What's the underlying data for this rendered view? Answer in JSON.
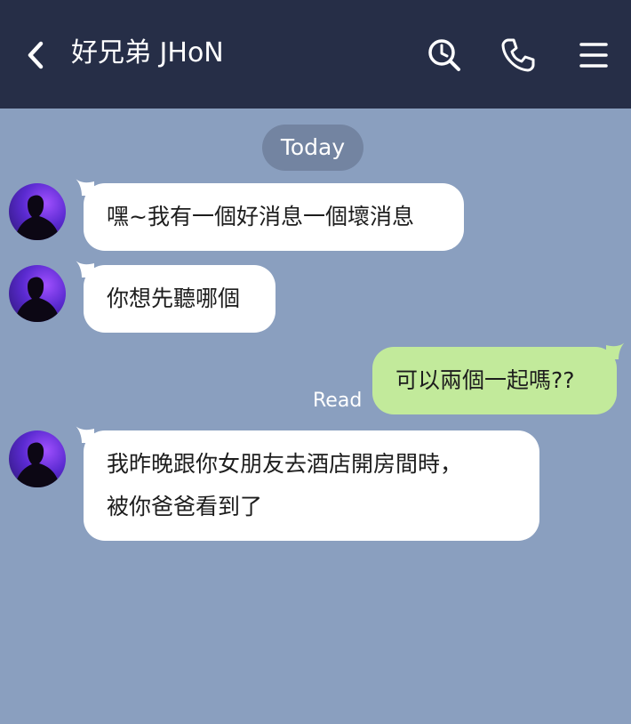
{
  "header": {
    "title": "好兄弟 JHoN",
    "icons": [
      "back-icon",
      "search-icon",
      "call-icon",
      "menu-icon"
    ]
  },
  "date_divider": "Today",
  "messages": [
    {
      "side": "in",
      "lines": [
        "嘿~我有一個好消息一個壞消息"
      ]
    },
    {
      "side": "in",
      "lines": [
        "你想先聽哪個"
      ]
    },
    {
      "side": "out",
      "lines": [
        "可以兩個一起嗎??"
      ],
      "status": "Read"
    },
    {
      "side": "in",
      "lines": [
        "我昨晚跟你女朋友去酒店開房間時，",
        "被你爸爸看到了"
      ]
    }
  ],
  "colors": {
    "header_bg": "#262e47",
    "chat_bg": "#8a9fbf",
    "incoming_bubble": "#ffffff",
    "outgoing_bubble": "#c2ea9b",
    "date_pill": "#7384a1"
  }
}
